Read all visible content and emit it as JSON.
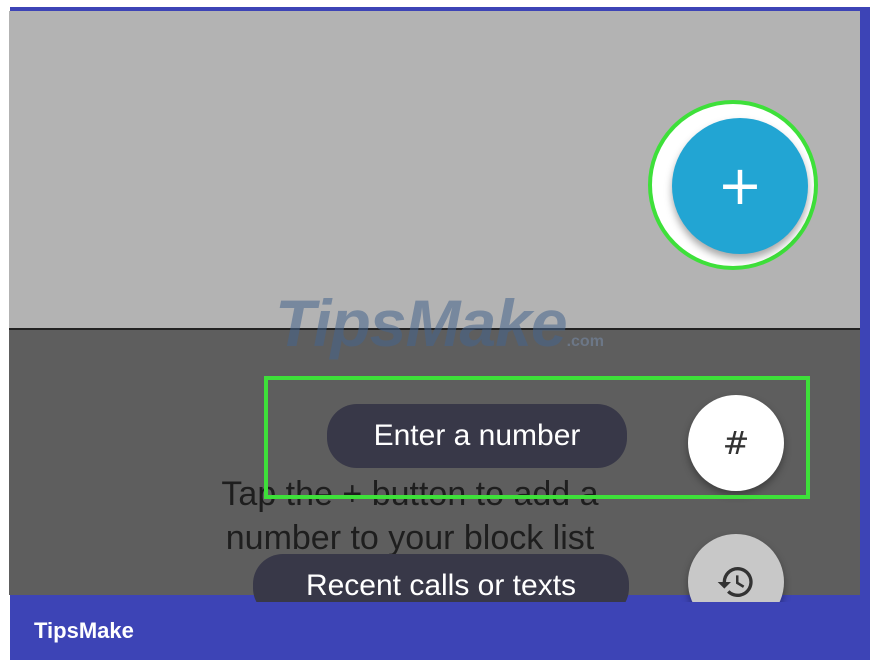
{
  "fab": {
    "label": "+"
  },
  "watermark": {
    "text": "TipsMake",
    "suffix": ".com"
  },
  "options": {
    "enter_number": {
      "label": "Enter a number",
      "icon": "#"
    },
    "recent": {
      "label": "Recent calls or texts",
      "icon": "history-icon"
    }
  },
  "instruction": {
    "line1": "Tap the + button to add a",
    "line2": "number to your block list"
  },
  "footer": {
    "brand": "TipsMake"
  },
  "colors": {
    "frame": "#3d44b6",
    "highlight": "#3ee03a",
    "fab": "#22a5d3",
    "pill": "#383848"
  }
}
